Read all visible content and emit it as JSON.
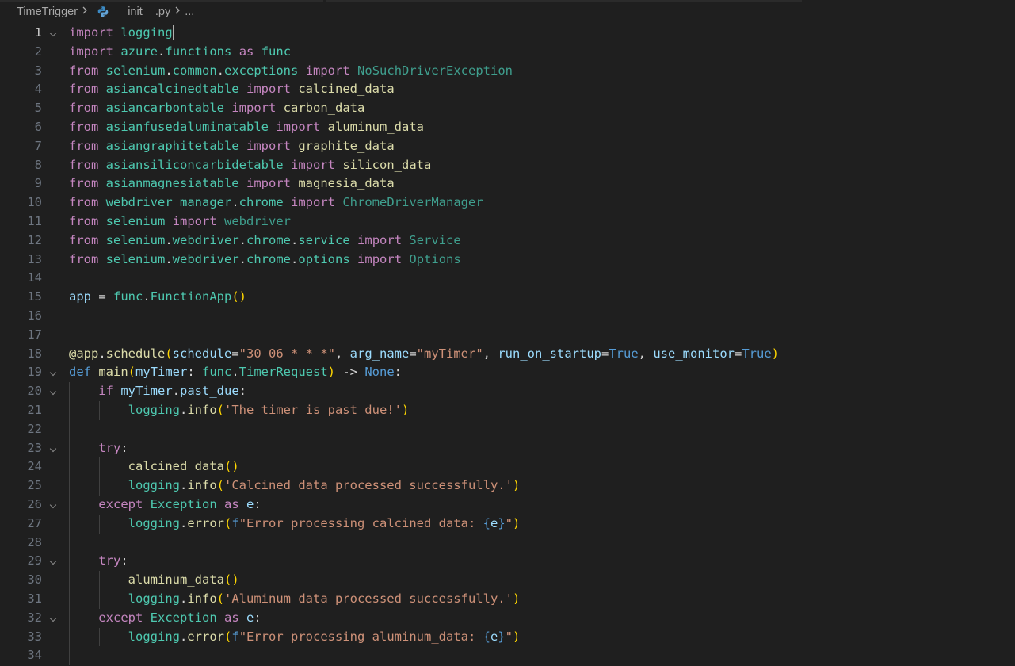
{
  "breadcrumb": {
    "folder": "TimeTrigger",
    "file": "__init__.py",
    "more": "..."
  },
  "colors": {
    "background": "#1f1f1f",
    "keyword": "#c586c0",
    "type": "#4ec9b0",
    "function": "#dcdcaa",
    "variable": "#9cdcfe",
    "string": "#ce9178",
    "constant": "#569cd6"
  },
  "icons": {
    "file_type": "python-file-icon",
    "separator": "chevron-right-icon",
    "fold": "chevron-down-icon"
  },
  "editor": {
    "active_line": 1,
    "lines": [
      {
        "n": "1",
        "tokens": [
          [
            "kw",
            "import"
          ],
          [
            "pl",
            " "
          ],
          [
            "mod",
            "logging"
          ]
        ]
      },
      {
        "n": "2",
        "tokens": [
          [
            "kw",
            "import"
          ],
          [
            "pl",
            " "
          ],
          [
            "mod",
            "azure"
          ],
          [
            "pl",
            "."
          ],
          [
            "mod",
            "functions"
          ],
          [
            "pl",
            " "
          ],
          [
            "kw",
            "as"
          ],
          [
            "pl",
            " "
          ],
          [
            "mod",
            "func"
          ]
        ]
      },
      {
        "n": "3",
        "tokens": [
          [
            "kw",
            "from"
          ],
          [
            "pl",
            " "
          ],
          [
            "mod",
            "selenium"
          ],
          [
            "pl",
            "."
          ],
          [
            "mod",
            "common"
          ],
          [
            "pl",
            "."
          ],
          [
            "mod",
            "exceptions"
          ],
          [
            "pl",
            " "
          ],
          [
            "kw",
            "import"
          ],
          [
            "pl",
            " "
          ],
          [
            "dim",
            "NoSuchDriverException"
          ]
        ]
      },
      {
        "n": "4",
        "tokens": [
          [
            "kw",
            "from"
          ],
          [
            "pl",
            " "
          ],
          [
            "mod",
            "asiancalcinedtable"
          ],
          [
            "pl",
            " "
          ],
          [
            "kw",
            "import"
          ],
          [
            "pl",
            " "
          ],
          [
            "fn",
            "calcined_data"
          ]
        ]
      },
      {
        "n": "5",
        "tokens": [
          [
            "kw",
            "from"
          ],
          [
            "pl",
            " "
          ],
          [
            "mod",
            "asiancarbontable"
          ],
          [
            "pl",
            " "
          ],
          [
            "kw",
            "import"
          ],
          [
            "pl",
            " "
          ],
          [
            "fn",
            "carbon_data"
          ]
        ]
      },
      {
        "n": "6",
        "tokens": [
          [
            "kw",
            "from"
          ],
          [
            "pl",
            " "
          ],
          [
            "mod",
            "asianfusedaluminatable"
          ],
          [
            "pl",
            " "
          ],
          [
            "kw",
            "import"
          ],
          [
            "pl",
            " "
          ],
          [
            "fn",
            "aluminum_data"
          ]
        ]
      },
      {
        "n": "7",
        "tokens": [
          [
            "kw",
            "from"
          ],
          [
            "pl",
            " "
          ],
          [
            "mod",
            "asiangraphitetable"
          ],
          [
            "pl",
            " "
          ],
          [
            "kw",
            "import"
          ],
          [
            "pl",
            " "
          ],
          [
            "fn",
            "graphite_data"
          ]
        ]
      },
      {
        "n": "8",
        "tokens": [
          [
            "kw",
            "from"
          ],
          [
            "pl",
            " "
          ],
          [
            "mod",
            "asiansiliconcarbidetable"
          ],
          [
            "pl",
            " "
          ],
          [
            "kw",
            "import"
          ],
          [
            "pl",
            " "
          ],
          [
            "fn",
            "silicon_data"
          ]
        ]
      },
      {
        "n": "9",
        "tokens": [
          [
            "kw",
            "from"
          ],
          [
            "pl",
            " "
          ],
          [
            "mod",
            "asianmagnesiatable"
          ],
          [
            "pl",
            " "
          ],
          [
            "kw",
            "import"
          ],
          [
            "pl",
            " "
          ],
          [
            "fn",
            "magnesia_data"
          ]
        ]
      },
      {
        "n": "10",
        "tokens": [
          [
            "kw",
            "from"
          ],
          [
            "pl",
            " "
          ],
          [
            "mod",
            "webdriver_manager"
          ],
          [
            "pl",
            "."
          ],
          [
            "mod",
            "chrome"
          ],
          [
            "pl",
            " "
          ],
          [
            "kw",
            "import"
          ],
          [
            "pl",
            " "
          ],
          [
            "dim",
            "ChromeDriverManager"
          ]
        ]
      },
      {
        "n": "11",
        "tokens": [
          [
            "kw",
            "from"
          ],
          [
            "pl",
            " "
          ],
          [
            "mod",
            "selenium"
          ],
          [
            "pl",
            " "
          ],
          [
            "kw",
            "import"
          ],
          [
            "pl",
            " "
          ],
          [
            "dim",
            "webdriver"
          ]
        ]
      },
      {
        "n": "12",
        "tokens": [
          [
            "kw",
            "from"
          ],
          [
            "pl",
            " "
          ],
          [
            "mod",
            "selenium"
          ],
          [
            "pl",
            "."
          ],
          [
            "mod",
            "webdriver"
          ],
          [
            "pl",
            "."
          ],
          [
            "mod",
            "chrome"
          ],
          [
            "pl",
            "."
          ],
          [
            "mod",
            "service"
          ],
          [
            "pl",
            " "
          ],
          [
            "kw",
            "import"
          ],
          [
            "pl",
            " "
          ],
          [
            "dim",
            "Service"
          ]
        ]
      },
      {
        "n": "13",
        "tokens": [
          [
            "kw",
            "from"
          ],
          [
            "pl",
            " "
          ],
          [
            "mod",
            "selenium"
          ],
          [
            "pl",
            "."
          ],
          [
            "mod",
            "webdriver"
          ],
          [
            "pl",
            "."
          ],
          [
            "mod",
            "chrome"
          ],
          [
            "pl",
            "."
          ],
          [
            "mod",
            "options"
          ],
          [
            "pl",
            " "
          ],
          [
            "kw",
            "import"
          ],
          [
            "pl",
            " "
          ],
          [
            "dim",
            "Options"
          ]
        ]
      },
      {
        "n": "14",
        "tokens": []
      },
      {
        "n": "15",
        "tokens": [
          [
            "var",
            "app"
          ],
          [
            "pl",
            " = "
          ],
          [
            "mod",
            "func"
          ],
          [
            "pl",
            "."
          ],
          [
            "cls",
            "FunctionApp"
          ],
          [
            "br1",
            "()"
          ]
        ]
      },
      {
        "n": "16",
        "tokens": []
      },
      {
        "n": "17",
        "tokens": []
      },
      {
        "n": "18",
        "tokens": [
          [
            "fn",
            "@app"
          ],
          [
            "pl",
            "."
          ],
          [
            "fn",
            "schedule"
          ],
          [
            "br1",
            "("
          ],
          [
            "var",
            "schedule"
          ],
          [
            "pl",
            "="
          ],
          [
            "str",
            "\"30 06 * * *\""
          ],
          [
            "pl",
            ", "
          ],
          [
            "var",
            "arg_name"
          ],
          [
            "pl",
            "="
          ],
          [
            "str",
            "\"myTimer\""
          ],
          [
            "pl",
            ", "
          ],
          [
            "var",
            "run_on_startup"
          ],
          [
            "pl",
            "="
          ],
          [
            "const",
            "True"
          ],
          [
            "pl",
            ", "
          ],
          [
            "var",
            "use_monitor"
          ],
          [
            "pl",
            "="
          ],
          [
            "const",
            "True"
          ],
          [
            "br1",
            ")"
          ]
        ]
      },
      {
        "n": "19",
        "tokens": [
          [
            "def",
            "def"
          ],
          [
            "pl",
            " "
          ],
          [
            "fn",
            "main"
          ],
          [
            "br1",
            "("
          ],
          [
            "var",
            "myTimer"
          ],
          [
            "pl",
            ": "
          ],
          [
            "mod",
            "func"
          ],
          [
            "pl",
            "."
          ],
          [
            "cls",
            "TimerRequest"
          ],
          [
            "br1",
            ")"
          ],
          [
            "pl",
            " -> "
          ],
          [
            "const",
            "None"
          ],
          [
            "pl",
            ":"
          ]
        ]
      },
      {
        "n": "20",
        "tokens": [
          [
            "pl",
            "    "
          ],
          [
            "kw",
            "if"
          ],
          [
            "pl",
            " "
          ],
          [
            "var",
            "myTimer"
          ],
          [
            "pl",
            "."
          ],
          [
            "var",
            "past_due"
          ],
          [
            "pl",
            ":"
          ]
        ]
      },
      {
        "n": "21",
        "tokens": [
          [
            "pl",
            "        "
          ],
          [
            "mod",
            "logging"
          ],
          [
            "pl",
            "."
          ],
          [
            "fn",
            "info"
          ],
          [
            "br1",
            "("
          ],
          [
            "str",
            "'The timer is past due!'"
          ],
          [
            "br1",
            ")"
          ]
        ]
      },
      {
        "n": "22",
        "tokens": []
      },
      {
        "n": "23",
        "tokens": [
          [
            "pl",
            "    "
          ],
          [
            "kw",
            "try"
          ],
          [
            "pl",
            ":"
          ]
        ]
      },
      {
        "n": "24",
        "tokens": [
          [
            "pl",
            "        "
          ],
          [
            "fn",
            "calcined_data"
          ],
          [
            "br1",
            "()"
          ]
        ]
      },
      {
        "n": "25",
        "tokens": [
          [
            "pl",
            "        "
          ],
          [
            "mod",
            "logging"
          ],
          [
            "pl",
            "."
          ],
          [
            "fn",
            "info"
          ],
          [
            "br1",
            "("
          ],
          [
            "str",
            "'Calcined data processed successfully.'"
          ],
          [
            "br1",
            ")"
          ]
        ]
      },
      {
        "n": "26",
        "tokens": [
          [
            "pl",
            "    "
          ],
          [
            "kw",
            "except"
          ],
          [
            "pl",
            " "
          ],
          [
            "cls",
            "Exception"
          ],
          [
            "pl",
            " "
          ],
          [
            "kw",
            "as"
          ],
          [
            "pl",
            " "
          ],
          [
            "var",
            "e"
          ],
          [
            "pl",
            ":"
          ]
        ]
      },
      {
        "n": "27",
        "tokens": [
          [
            "pl",
            "        "
          ],
          [
            "mod",
            "logging"
          ],
          [
            "pl",
            "."
          ],
          [
            "fn",
            "error"
          ],
          [
            "br1",
            "("
          ],
          [
            "const",
            "f"
          ],
          [
            "str",
            "\"Error processing calcined_data: "
          ],
          [
            "const",
            "{"
          ],
          [
            "var",
            "e"
          ],
          [
            "const",
            "}"
          ],
          [
            "str",
            "\""
          ],
          [
            "br1",
            ")"
          ]
        ]
      },
      {
        "n": "28",
        "tokens": []
      },
      {
        "n": "29",
        "tokens": [
          [
            "pl",
            "    "
          ],
          [
            "kw",
            "try"
          ],
          [
            "pl",
            ":"
          ]
        ]
      },
      {
        "n": "30",
        "tokens": [
          [
            "pl",
            "        "
          ],
          [
            "fn",
            "aluminum_data"
          ],
          [
            "br1",
            "()"
          ]
        ]
      },
      {
        "n": "31",
        "tokens": [
          [
            "pl",
            "        "
          ],
          [
            "mod",
            "logging"
          ],
          [
            "pl",
            "."
          ],
          [
            "fn",
            "info"
          ],
          [
            "br1",
            "("
          ],
          [
            "str",
            "'Aluminum data processed successfully.'"
          ],
          [
            "br1",
            ")"
          ]
        ]
      },
      {
        "n": "32",
        "tokens": [
          [
            "pl",
            "    "
          ],
          [
            "kw",
            "except"
          ],
          [
            "pl",
            " "
          ],
          [
            "cls",
            "Exception"
          ],
          [
            "pl",
            " "
          ],
          [
            "kw",
            "as"
          ],
          [
            "pl",
            " "
          ],
          [
            "var",
            "e"
          ],
          [
            "pl",
            ":"
          ]
        ]
      },
      {
        "n": "33",
        "tokens": [
          [
            "pl",
            "        "
          ],
          [
            "mod",
            "logging"
          ],
          [
            "pl",
            "."
          ],
          [
            "fn",
            "error"
          ],
          [
            "br1",
            "("
          ],
          [
            "const",
            "f"
          ],
          [
            "str",
            "\"Error processing aluminum_data: "
          ],
          [
            "const",
            "{"
          ],
          [
            "var",
            "e"
          ],
          [
            "const",
            "}"
          ],
          [
            "str",
            "\""
          ],
          [
            "br1",
            ")"
          ]
        ]
      },
      {
        "n": "34",
        "tokens": []
      }
    ]
  }
}
